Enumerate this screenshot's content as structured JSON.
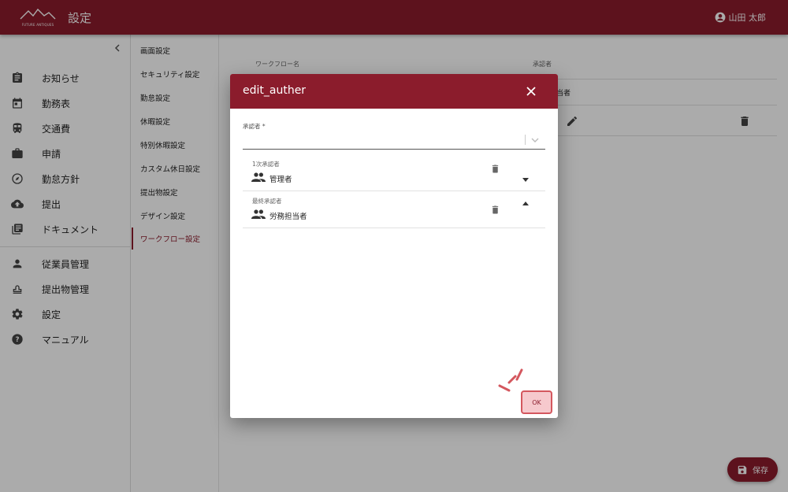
{
  "header": {
    "logo_text": "FUTURE ANTIQUES",
    "title": "設定",
    "user_name": "山田 太郎"
  },
  "sidebar": {
    "items": [
      {
        "label": "お知らせ",
        "icon": "clipboard-icon"
      },
      {
        "label": "勤務表",
        "icon": "calendar-icon"
      },
      {
        "label": "交通費",
        "icon": "train-icon"
      },
      {
        "label": "申請",
        "icon": "briefcase-icon"
      },
      {
        "label": "勤怠方針",
        "icon": "compass-icon"
      },
      {
        "label": "提出",
        "icon": "cloud-upload-icon"
      },
      {
        "label": "ドキュメント",
        "icon": "library-icon"
      },
      {
        "label": "従業員管理",
        "icon": "person-icon"
      },
      {
        "label": "提出物管理",
        "icon": "stamp-icon"
      },
      {
        "label": "設定",
        "icon": "gear-icon"
      },
      {
        "label": "マニュアル",
        "icon": "help-icon"
      }
    ]
  },
  "submenu": {
    "items": [
      {
        "label": "画面設定"
      },
      {
        "label": "セキュリティ設定"
      },
      {
        "label": "勤怠設定"
      },
      {
        "label": "休暇設定"
      },
      {
        "label": "特別休暇設定"
      },
      {
        "label": "カスタム休日設定"
      },
      {
        "label": "提出物設定"
      },
      {
        "label": "デザイン設定"
      },
      {
        "label": "ワークフロー設定"
      }
    ],
    "active_index": 8
  },
  "main": {
    "col_workflow_name": "ワークフロー名",
    "col_approver": "承認者",
    "row1_approver_fragment": "当者",
    "save_label": "保存"
  },
  "dialog": {
    "title": "edit_auther",
    "field_label": "承認者 *",
    "approvers": [
      {
        "stage": "1次承認者",
        "name": "管理者"
      },
      {
        "stage": "最終承認者",
        "name": "労務担当者"
      }
    ],
    "ok_label": "OK"
  },
  "colors": {
    "brand": "#8b1c2c",
    "ok_fill": "#f6c9cd",
    "ok_border": "#d4575e"
  }
}
